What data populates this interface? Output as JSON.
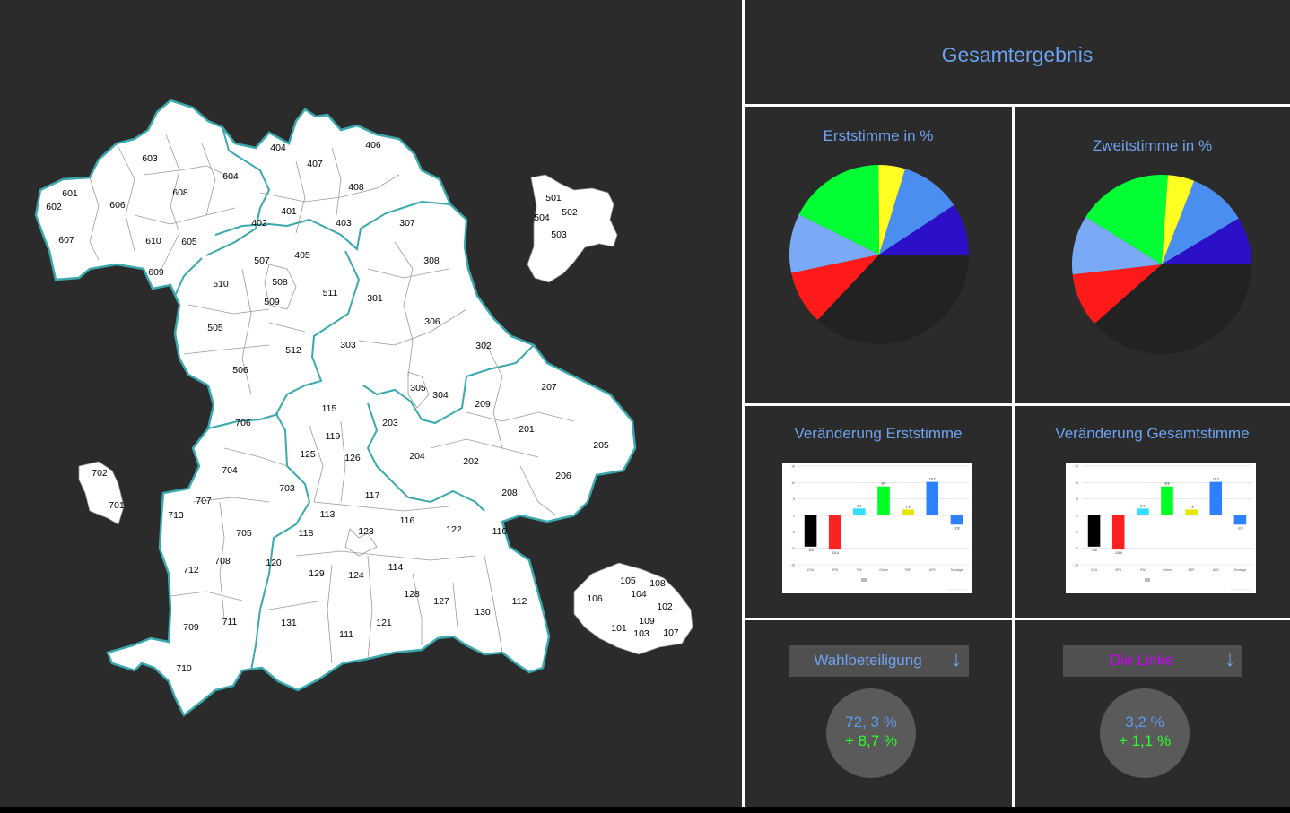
{
  "header": {
    "title": "Gesamtergebnis"
  },
  "colors": {
    "accent": "#6ea3f0",
    "cdu": "#000000",
    "spd": "#ff2020",
    "fw": "#33ddff",
    "gruene": "#00ff22",
    "fdp": "#e6e600",
    "afd": "#2f80ff",
    "sonstige": "#2040ff",
    "linke": "#cc00ff"
  },
  "map": {
    "districts": [
      "601",
      "602",
      "603",
      "604",
      "606",
      "607",
      "608",
      "609",
      "610",
      "605",
      "404",
      "407",
      "406",
      "408",
      "401",
      "402",
      "403",
      "405",
      "307",
      "308",
      "301",
      "306",
      "302",
      "303",
      "305",
      "304",
      "207",
      "209",
      "201",
      "205",
      "206",
      "202",
      "204",
      "203",
      "208",
      "507",
      "508",
      "509",
      "510",
      "511",
      "512",
      "505",
      "506",
      "115",
      "119",
      "125",
      "126",
      "117",
      "113",
      "116",
      "118",
      "123",
      "122",
      "110",
      "120",
      "129",
      "124",
      "114",
      "128",
      "127",
      "130",
      "112",
      "131",
      "111",
      "121",
      "706",
      "704",
      "703",
      "707",
      "713",
      "705",
      "712",
      "708",
      "711",
      "709",
      "710",
      "702",
      "701",
      "501",
      "502",
      "504",
      "503",
      "106",
      "105",
      "108",
      "104",
      "102",
      "109",
      "101",
      "103",
      "107"
    ]
  },
  "erststimme": {
    "title": "Erststimme in %",
    "chart_data": {
      "type": "pie",
      "title": "Erststimme in %",
      "slices": [
        {
          "color": "#222222",
          "value": 37.0
        },
        {
          "color": "#ff1a1a",
          "value": 9.7
        },
        {
          "color": "#7aaaf5",
          "value": 10.7
        },
        {
          "color": "#00ff33",
          "value": 17.5
        },
        {
          "color": "#ffff22",
          "value": 4.8
        },
        {
          "color": "#4a8ff0",
          "value": 11.0
        },
        {
          "color": "#2b10c8",
          "value": 9.3
        }
      ]
    }
  },
  "zweitstimme": {
    "title": "Zweitstimme in %",
    "chart_data": {
      "type": "pie",
      "title": "Zweitstimme in %",
      "slices": [
        {
          "color": "#222222",
          "value": 38.5
        },
        {
          "color": "#ff1a1a",
          "value": 9.7
        },
        {
          "color": "#7aaaf5",
          "value": 10.7
        },
        {
          "color": "#00ff33",
          "value": 17.2
        },
        {
          "color": "#ffff22",
          "value": 4.8
        },
        {
          "color": "#4a8ff0",
          "value": 10.5
        },
        {
          "color": "#2b10c8",
          "value": 8.6
        }
      ]
    }
  },
  "veraenderung_erststimme": {
    "title": "Veränderung Erststimme",
    "chart_data": {
      "type": "bar",
      "categories": [
        "CSU",
        "SPD",
        "FW",
        "Grüne",
        "FDP",
        "AFD",
        "Sonstige"
      ],
      "values": [
        -9.5,
        -10.4,
        2.1,
        8.8,
        1.8,
        10.2,
        -2.8
      ],
      "value_labels": [
        "-9.5",
        "-10.4",
        "2.1",
        "8.8",
        "1.8",
        "10.2",
        "-2.8"
      ],
      "colors": [
        "#000000",
        "#ff2020",
        "#33ddff",
        "#00ff22",
        "#e6e600",
        "#2f80ff",
        "#2f80ff"
      ],
      "ylim": [
        -15,
        15
      ],
      "yticks": [
        "15",
        "10",
        "5",
        "0",
        "-5",
        "-10",
        "-15"
      ],
      "grid": true
    }
  },
  "veraenderung_gesamtstimme": {
    "title": "Veränderung Gesamtstimme",
    "chart_data": {
      "type": "bar",
      "categories": [
        "CSU",
        "SPD",
        "FW",
        "Grüne",
        "FDP",
        "AFD",
        "Sonstige"
      ],
      "values": [
        -9.5,
        -10.4,
        2.1,
        8.8,
        1.8,
        10.2,
        -2.8
      ],
      "value_labels": [
        "-9.5",
        "-10.4",
        "2.1",
        "8.8",
        "1.8",
        "10.2",
        "-2.8"
      ],
      "colors": [
        "#000000",
        "#ff2020",
        "#33ddff",
        "#00ff22",
        "#e6e600",
        "#2f80ff",
        "#2f80ff"
      ],
      "ylim": [
        -15,
        15
      ],
      "yticks": [
        "15",
        "10",
        "5",
        "0",
        "-5",
        "-10",
        "-15"
      ],
      "grid": true
    }
  },
  "wahlbeteiligung": {
    "select_label": "Wahlbeteiligung",
    "arrow": "↓",
    "value": "72, 3 %",
    "change": "+ 8,7 %"
  },
  "partei": {
    "select_label": "Die Linke",
    "arrow": "↓",
    "value": "3,2 %",
    "change": "+ 1,1 %"
  }
}
